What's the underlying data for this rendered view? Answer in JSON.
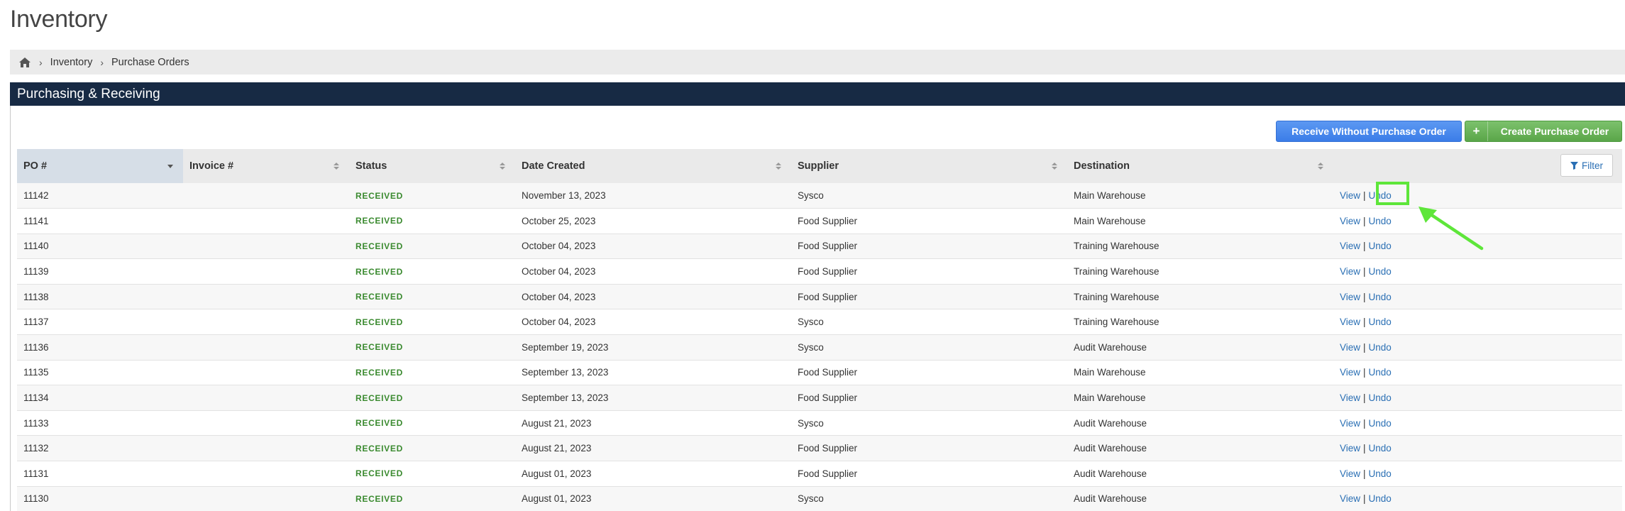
{
  "page": {
    "title": "Inventory"
  },
  "breadcrumb": {
    "items": [
      "Inventory",
      "Purchase Orders"
    ]
  },
  "panel": {
    "title": "Purchasing & Receiving"
  },
  "buttons": {
    "receive_without_po": "Receive Without Purchase Order",
    "create_po_plus": "+",
    "create_po": "Create Purchase Order",
    "filter": "Filter"
  },
  "table": {
    "columns": [
      "PO #",
      "Invoice #",
      "Status",
      "Date Created",
      "Supplier",
      "Destination"
    ],
    "action_view": "View",
    "action_sep": "|",
    "action_undo": "Undo",
    "rows": [
      {
        "po": "11142",
        "invoice": "",
        "status": "RECEIVED",
        "date": "November 13, 2023",
        "supplier": "Sysco",
        "destination": "Main Warehouse"
      },
      {
        "po": "11141",
        "invoice": "",
        "status": "RECEIVED",
        "date": "October 25, 2023",
        "supplier": "Food Supplier",
        "destination": "Main Warehouse"
      },
      {
        "po": "11140",
        "invoice": "",
        "status": "RECEIVED",
        "date": "October 04, 2023",
        "supplier": "Food Supplier",
        "destination": "Training Warehouse"
      },
      {
        "po": "11139",
        "invoice": "",
        "status": "RECEIVED",
        "date": "October 04, 2023",
        "supplier": "Food Supplier",
        "destination": "Training Warehouse"
      },
      {
        "po": "11138",
        "invoice": "",
        "status": "RECEIVED",
        "date": "October 04, 2023",
        "supplier": "Food Supplier",
        "destination": "Training Warehouse"
      },
      {
        "po": "11137",
        "invoice": "",
        "status": "RECEIVED",
        "date": "October 04, 2023",
        "supplier": "Sysco",
        "destination": "Training Warehouse"
      },
      {
        "po": "11136",
        "invoice": "",
        "status": "RECEIVED",
        "date": "September 19, 2023",
        "supplier": "Sysco",
        "destination": "Audit Warehouse"
      },
      {
        "po": "11135",
        "invoice": "",
        "status": "RECEIVED",
        "date": "September 13, 2023",
        "supplier": "Food Supplier",
        "destination": "Main Warehouse"
      },
      {
        "po": "11134",
        "invoice": "",
        "status": "RECEIVED",
        "date": "September 13, 2023",
        "supplier": "Food Supplier",
        "destination": "Main Warehouse"
      },
      {
        "po": "11133",
        "invoice": "",
        "status": "RECEIVED",
        "date": "August 21, 2023",
        "supplier": "Sysco",
        "destination": "Audit Warehouse"
      },
      {
        "po": "11132",
        "invoice": "",
        "status": "RECEIVED",
        "date": "August 21, 2023",
        "supplier": "Food Supplier",
        "destination": "Audit Warehouse"
      },
      {
        "po": "11131",
        "invoice": "",
        "status": "RECEIVED",
        "date": "August 01, 2023",
        "supplier": "Food Supplier",
        "destination": "Audit Warehouse"
      },
      {
        "po": "11130",
        "invoice": "",
        "status": "RECEIVED",
        "date": "August 01, 2023",
        "supplier": "Sysco",
        "destination": "Audit Warehouse"
      }
    ]
  },
  "colors": {
    "header_bar": "#172a44",
    "status_received": "#3a8a2f",
    "link": "#2a6fb4",
    "annotation": "#5ee63a"
  }
}
